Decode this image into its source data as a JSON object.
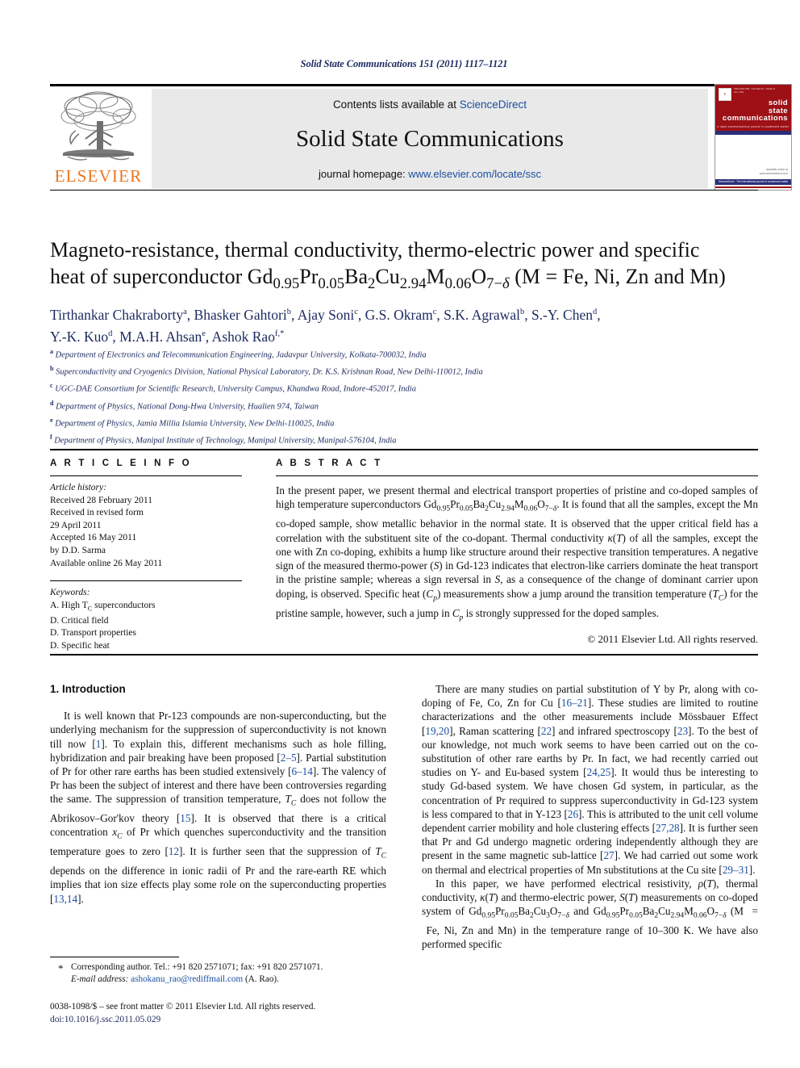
{
  "running_head": "Solid State Communications 151 (2011) 1117–1121",
  "masthead": {
    "publisher_name": "ELSEVIER",
    "contents_prefix": "Contents lists available at ",
    "sciencedirect": "ScienceDirect",
    "journal_title": "Solid State Communications",
    "homepage_prefix": "journal homepage: ",
    "homepage_url": "www.elsevier.com/locate/ssc",
    "cover": {
      "journal_line1": "solid",
      "journal_line2": "state",
      "journal_line3": "communications",
      "tagline": "a rapid communications journal in condensed matter",
      "footer_line1": "available online at",
      "footer_line2": "www.sciencedirect.com",
      "footer_band": "ScienceDirect · The international journal of condensed matter"
    }
  },
  "title": {
    "line1": "Magneto-resistance, thermal conductivity, thermo-electric power and specific",
    "line2_prefix": "heat of superconductor Gd",
    "formula": "Gd0.95Pr0.05Ba2Cu2.94M0.06O7−δ",
    "suffix": " (M = Fe, Ni, Zn and Mn)"
  },
  "authors": [
    {
      "name": "Tirthankar Chakraborty",
      "sup": "a"
    },
    {
      "name": "Bhasker Gahtori",
      "sup": "b"
    },
    {
      "name": "Ajay Soni",
      "sup": "c"
    },
    {
      "name": "G.S. Okram",
      "sup": "c"
    },
    {
      "name": "S.K. Agrawal",
      "sup": "b"
    },
    {
      "name": "S.-Y. Chen",
      "sup": "d"
    },
    {
      "name": "Y.-K. Kuo",
      "sup": "d"
    },
    {
      "name": "M.A.H. Ahsan",
      "sup": "e"
    },
    {
      "name": "Ashok Rao",
      "sup": "f,*"
    }
  ],
  "affiliations": [
    {
      "key": "a",
      "text": "Department of Electronics and Telecommunication Engineering, Jadavpur University, Kolkata-700032, India"
    },
    {
      "key": "b",
      "text": "Superconductivity and Cryogenics Division, National Physical Laboratory, Dr. K.S. Krishnan Road, New Delhi-110012, India"
    },
    {
      "key": "c",
      "text": "UGC-DAE Consortium for Scientific Research, University Campus, Khandwa Road, Indore-452017, India"
    },
    {
      "key": "d",
      "text": "Department of Physics, National Dong-Hwa University, Hualien 974, Taiwan"
    },
    {
      "key": "e",
      "text": "Department of Physics, Jamia Millia Islamia University, New Delhi-110025, India"
    },
    {
      "key": "f",
      "text": "Department of Physics, Manipal Institute of Technology, Manipal University, Manipal-576104, India"
    }
  ],
  "article_info": {
    "heading": "A R T I C L E   I N F O",
    "history_label": "Article history:",
    "history": [
      "Received 28 February 2011",
      "Received in revised form",
      "29 April 2011",
      "Accepted 16 May 2011",
      "by D.D. Sarma",
      "Available online 26 May 2011"
    ],
    "keywords_label": "Keywords:",
    "keywords": [
      "A. High Tc superconductors",
      "D. Critical field",
      "D. Transport properties",
      "D. Specific heat"
    ]
  },
  "abstract": {
    "heading": "A B S T R A C T",
    "text": "In the present paper, we present thermal and electrical transport properties of pristine and co-doped samples of high temperature superconductors Gd0.95Pr0.05Ba2Cu2.94M0.06O7−δ. It is found that all the samples, except the Mn co-doped sample, show metallic behavior in the normal state. It is observed that the upper critical field has a correlation with the substituent site of the co-dopant. Thermal conductivity κ(T) of all the samples, except the one with Zn co-doping, exhibits a hump like structure around their respective transition temperatures. A negative sign of the measured thermo-power (S) in Gd-123 indicates that electron-like carriers dominate the heat transport in the pristine sample; whereas a sign reversal in S, as a consequence of the change of dominant carrier upon doping, is observed. Specific heat (Cp) measurements show a jump around the transition temperature (Tc) for the pristine sample, however, such a jump in Cp is strongly suppressed for the doped samples.",
    "copyright": "© 2011 Elsevier Ltd. All rights reserved."
  },
  "body": {
    "section1_title": "1. Introduction",
    "left_para1": "It is well known that Pr-123 compounds are non-superconducting, but the underlying mechanism for the suppression of superconductivity is not known till now [1]. To explain this, different mechanisms such as hole filling, hybridization and pair breaking have been proposed [2–5]. Partial substitution of Pr for other rare earths has been studied extensively [6–14]. The valency of Pr has been the subject of interest and there have been controversies regarding the same. The suppression of transition temperature, Tc does not follow the Abrikosov–Gor'kov theory [15]. It is observed that there is a critical concentration xc of Pr which quenches superconductivity and the transition temperature goes to zero [12]. It is further seen that the suppression of Tc depends on the difference in ionic radii of Pr and the rare-earth RE which implies that ion size effects play some role on the superconducting properties [13,14].",
    "right_para1": "There are many studies on partial substitution of Y by Pr, along with co-doping of Fe, Co, Zn for Cu [16–21]. These studies are limited to routine characterizations and the other measurements include Mössbauer Effect [19,20], Raman scattering [22] and infrared spectroscopy [23]. To the best of our knowledge, not much work seems to have been carried out on the co-substitution of other rare earths by Pr. In fact, we had recently carried out studies on Y- and Eu-based system [24,25]. It would thus be interesting to study Gd-based system. We have chosen Gd system, in particular, as the concentration of Pr required to suppress superconductivity in Gd-123 system is less compared to that in Y-123 [26]. This is attributed to the unit cell volume dependent carrier mobility and hole clustering effects [27,28]. It is further seen that Pr and Gd undergo magnetic ordering independently although they are present in the same magnetic sub-lattice [27]. We had carried out some work on thermal and electrical properties of Mn substitutions at the Cu site [29–31].",
    "right_para2": "In this paper, we have performed electrical resistivity, ρ(T), thermal conductivity, κ(T) and thermo-electric power, S(T) measurements on co-doped system of Gd0.95Pr0.05Ba2Cu3O7−δ and Gd0.95Pr0.05Ba2Cu2.94M0.06O7−δ (M = Fe, Ni, Zn and Mn) in the temperature range of 10–300 K. We have also performed specific"
  },
  "footer": {
    "corresponding_author": "Corresponding author. Tel.: +91 820 2571071; fax: +91 820 2571071.",
    "email_label": "E-mail address:",
    "email": "ashokanu_rao@rediffmail.com",
    "email_suffix": "(A. Rao).",
    "issn_line": "0038-1098/$ – see front matter © 2011 Elsevier Ltd. All rights reserved.",
    "doi_line": "doi:10.1016/j.ssc.2011.05.029"
  },
  "colors": {
    "link": "#1a4fa0",
    "navy": "#1b2a5e",
    "elsevier_orange": "#E87722",
    "cover_red": "#9c1016",
    "banner_grey": "#e9e9e9"
  }
}
